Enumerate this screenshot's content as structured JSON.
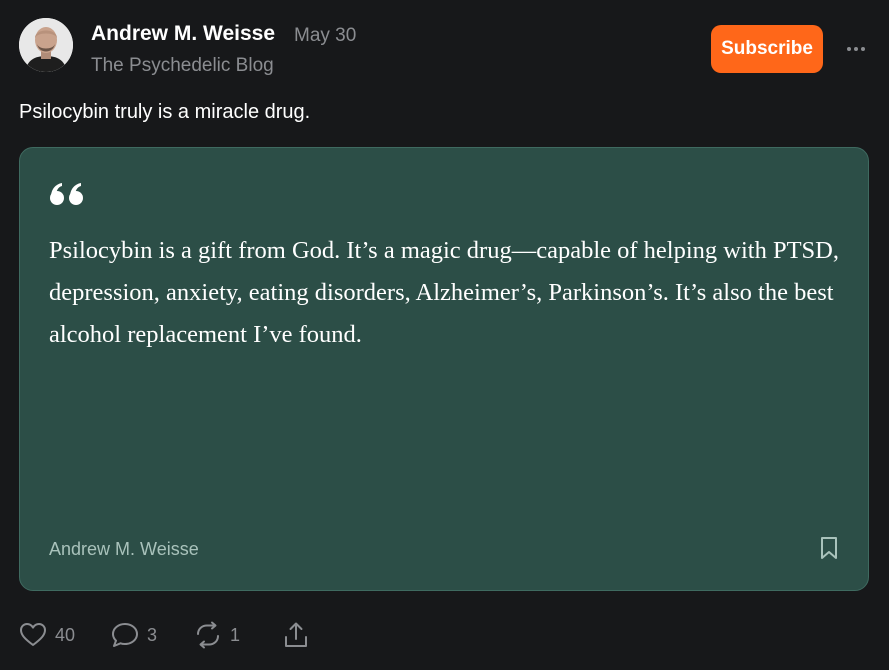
{
  "post": {
    "author": "Andrew M. Weisse",
    "date": "May 30",
    "publication": "The Psychedelic Blog",
    "text": "Psilocybin truly is a miracle drug."
  },
  "header": {
    "subscribe_label": "Subscribe",
    "more_icon": "more-horizontal-icon"
  },
  "quote": {
    "icon": "quote-mark-icon",
    "body": "Psilocybin is a gift from God. It’s a magic drug—capable of helping with PTSD, depression, anxiety, eating disorders, Alzheimer’s, Parkinson’s. It’s also the best alcohol replacement I’ve found.",
    "attribution": "Andrew M. Weisse",
    "bookmark_icon": "bookmark-icon"
  },
  "actions": {
    "likes": "40",
    "comments": "3",
    "restacks": "1",
    "like_icon": "heart-icon",
    "comment_icon": "comment-icon",
    "restack_icon": "restack-icon",
    "share_icon": "share-icon"
  },
  "colors": {
    "background": "#17181a",
    "accent": "#ff6719",
    "card": "#2c4e47",
    "muted_text": "#8b8d91"
  }
}
